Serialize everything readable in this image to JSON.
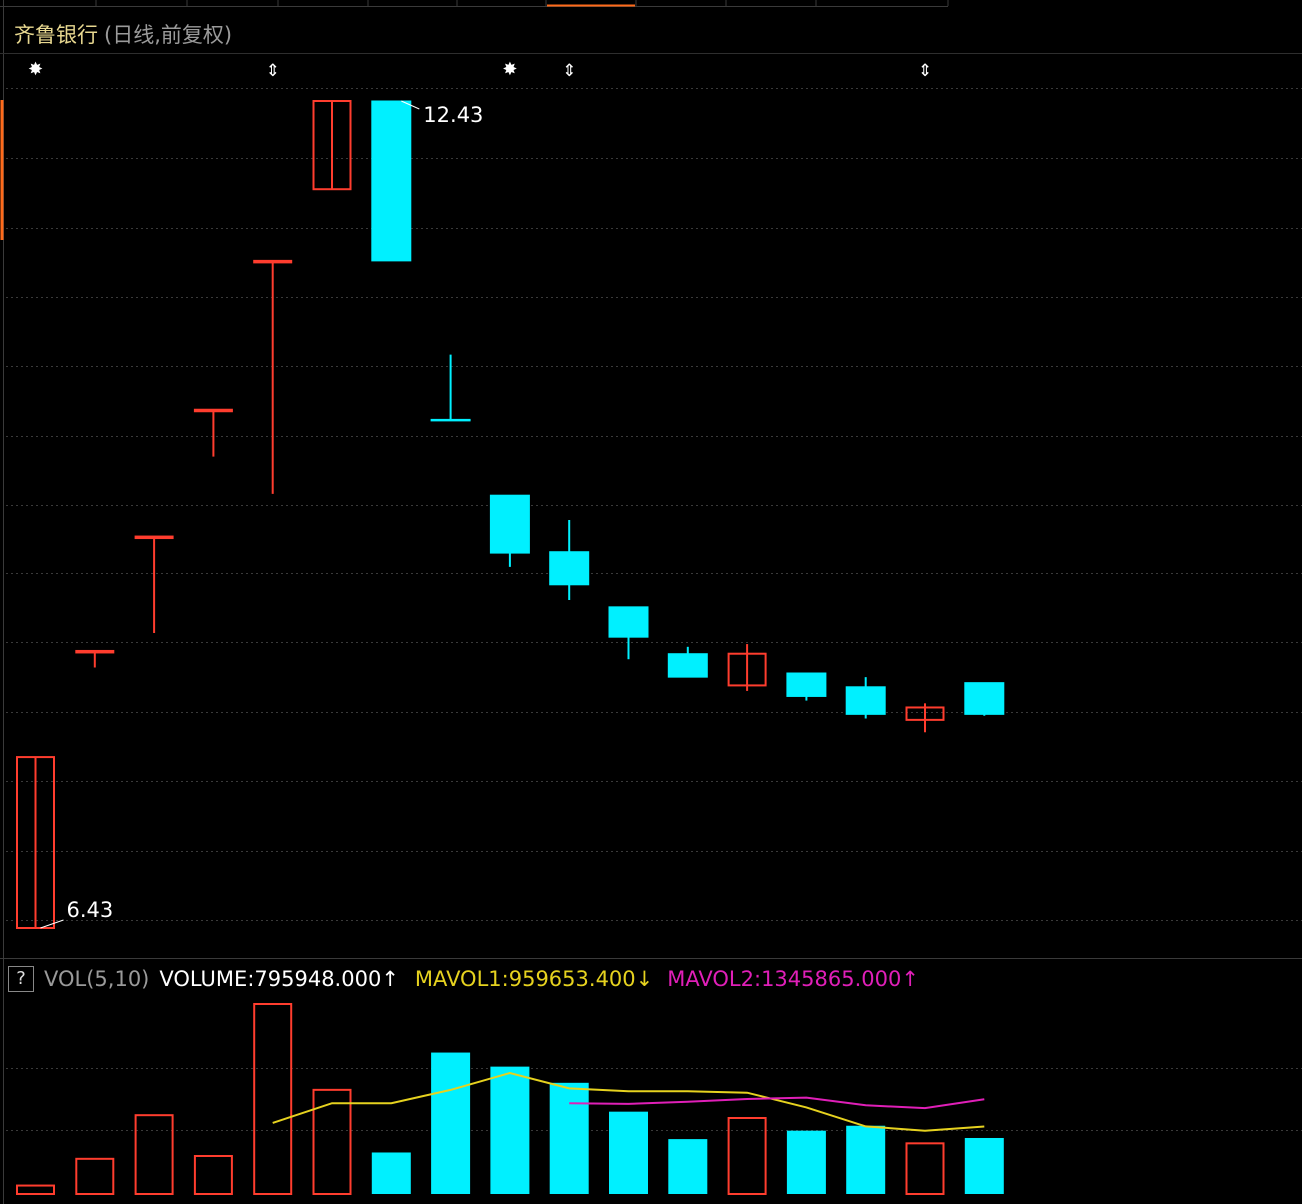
{
  "header": {
    "stock_name": "齐鲁银行",
    "period": "(日线,前复权)"
  },
  "colors": {
    "up": "#ff3d2e",
    "down": "#00f0ff",
    "grid": "#3a3a3a",
    "mavol1": "#e6d21f",
    "mavol2": "#e01fb8",
    "tab_active": "#ff6a1a"
  },
  "markers": [
    "star",
    "arrows",
    "star",
    "arrows",
    "arrows"
  ],
  "volume_panel": {
    "help": "?",
    "indicator": "VOL(5,10)",
    "volume": "VOLUME:795948.000",
    "mavol1": "MAVOL1:959653.400",
    "mavol2": "MAVOL2:1345865.000",
    "volume_dir": "↑",
    "mavol1_dir": "↓",
    "mavol2_dir": "↑"
  },
  "chart_data": {
    "type": "candlestick",
    "title": "齐鲁银行",
    "ylim": [
      6.4,
      12.6
    ],
    "annotations": {
      "high": "12.43",
      "low": "6.43"
    },
    "candles": [
      {
        "open": 6.43,
        "close": 7.67,
        "high": 7.67,
        "low": 6.43,
        "up": true,
        "marker": "star"
      },
      {
        "open": 8.44,
        "close": 8.44,
        "high": 8.44,
        "low": 8.32,
        "up": true
      },
      {
        "open": 9.27,
        "close": 9.27,
        "high": 9.27,
        "low": 8.57,
        "up": true
      },
      {
        "open": 10.19,
        "close": 10.19,
        "high": 10.19,
        "low": 9.85,
        "up": true
      },
      {
        "open": 11.27,
        "close": 11.27,
        "high": 11.27,
        "low": 9.58,
        "up": true,
        "marker": "arrows"
      },
      {
        "open": 11.79,
        "close": 12.43,
        "high": 12.43,
        "low": 11.79,
        "up": true
      },
      {
        "open": 12.43,
        "close": 11.27,
        "high": 12.43,
        "low": 11.27,
        "up": false
      },
      {
        "open": 10.12,
        "close": 10.12,
        "high": 10.59,
        "low": 10.12,
        "up": false
      },
      {
        "open": 9.57,
        "close": 9.15,
        "high": 9.57,
        "low": 9.05,
        "up": false,
        "marker": "star"
      },
      {
        "open": 9.16,
        "close": 8.92,
        "high": 9.39,
        "low": 8.81,
        "up": false,
        "marker": "arrows"
      },
      {
        "open": 8.76,
        "close": 8.54,
        "high": 8.76,
        "low": 8.38,
        "up": false
      },
      {
        "open": 8.42,
        "close": 8.25,
        "high": 8.47,
        "low": 8.25,
        "up": false
      },
      {
        "open": 8.19,
        "close": 8.42,
        "high": 8.49,
        "low": 8.15,
        "up": true
      },
      {
        "open": 8.28,
        "close": 8.11,
        "high": 8.28,
        "low": 8.08,
        "up": false
      },
      {
        "open": 8.18,
        "close": 7.98,
        "high": 8.25,
        "low": 7.95,
        "up": false
      },
      {
        "open": 7.94,
        "close": 8.03,
        "high": 8.06,
        "low": 7.85,
        "up": true,
        "marker": "arrows"
      },
      {
        "open": 8.21,
        "close": 7.98,
        "high": 8.21,
        "low": 7.97,
        "up": false
      }
    ],
    "volume": {
      "ylim": [
        0,
        2700000
      ],
      "values": [
        120000,
        500000,
        1120000,
        540000,
        2700000,
        1480000,
        590000,
        2010000,
        1810000,
        1580000,
        1170000,
        780000,
        1080000,
        900000,
        970000,
        720000,
        795948
      ],
      "mavol1": [
        null,
        null,
        null,
        null,
        1010000,
        1290000,
        1290000,
        1480000,
        1720000,
        1500000,
        1460000,
        1460000,
        1440000,
        1230000,
        960000,
        900000,
        959653
      ],
      "mavol2": [
        null,
        null,
        null,
        null,
        null,
        null,
        null,
        null,
        null,
        1290000,
        1280000,
        1310000,
        1350000,
        1370000,
        1260000,
        1220000,
        1345865
      ]
    }
  }
}
